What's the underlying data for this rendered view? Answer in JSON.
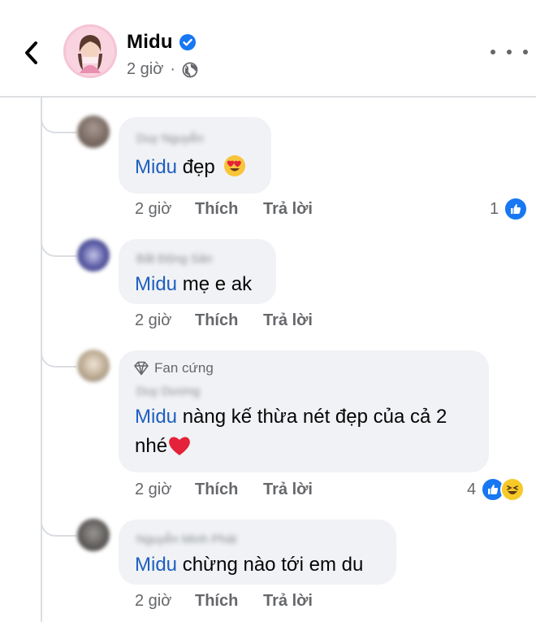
{
  "header": {
    "page_name": "Midu",
    "time": "2 giờ",
    "separator": "·"
  },
  "actions": {
    "like": "Thích",
    "reply": "Trả lời"
  },
  "colors": {
    "mention": "#1f5fbf",
    "verified": "#1877f2",
    "like_reaction": "#1877f2",
    "haha_reaction": "#f7c928",
    "heart": "#e4223a"
  },
  "comments": [
    {
      "author": "Duy Nguyễn",
      "mention": "Midu",
      "text": "đẹp",
      "emoji": "smiling-face-with-heart-eyes-icon",
      "time": "2 giờ",
      "reaction_count": "1",
      "reactions": [
        "like"
      ]
    },
    {
      "author": "Bất Động Sản",
      "mention": "Midu",
      "text": "mẹ e ak",
      "time": "2 giờ"
    },
    {
      "badge": "Fan cứng",
      "author": "Duy Dương",
      "mention": "Midu",
      "text_line1": "nàng kế thừa nét đẹp của cả 2",
      "text_line2": "nhé",
      "emoji": "red-heart-icon",
      "time": "2 giờ",
      "reaction_count": "4",
      "reactions": [
        "like",
        "haha"
      ]
    },
    {
      "author": "Nguyễn Minh Phát",
      "mention": "Midu",
      "text": "chừng nào tới em du",
      "time": "2 giờ"
    }
  ]
}
